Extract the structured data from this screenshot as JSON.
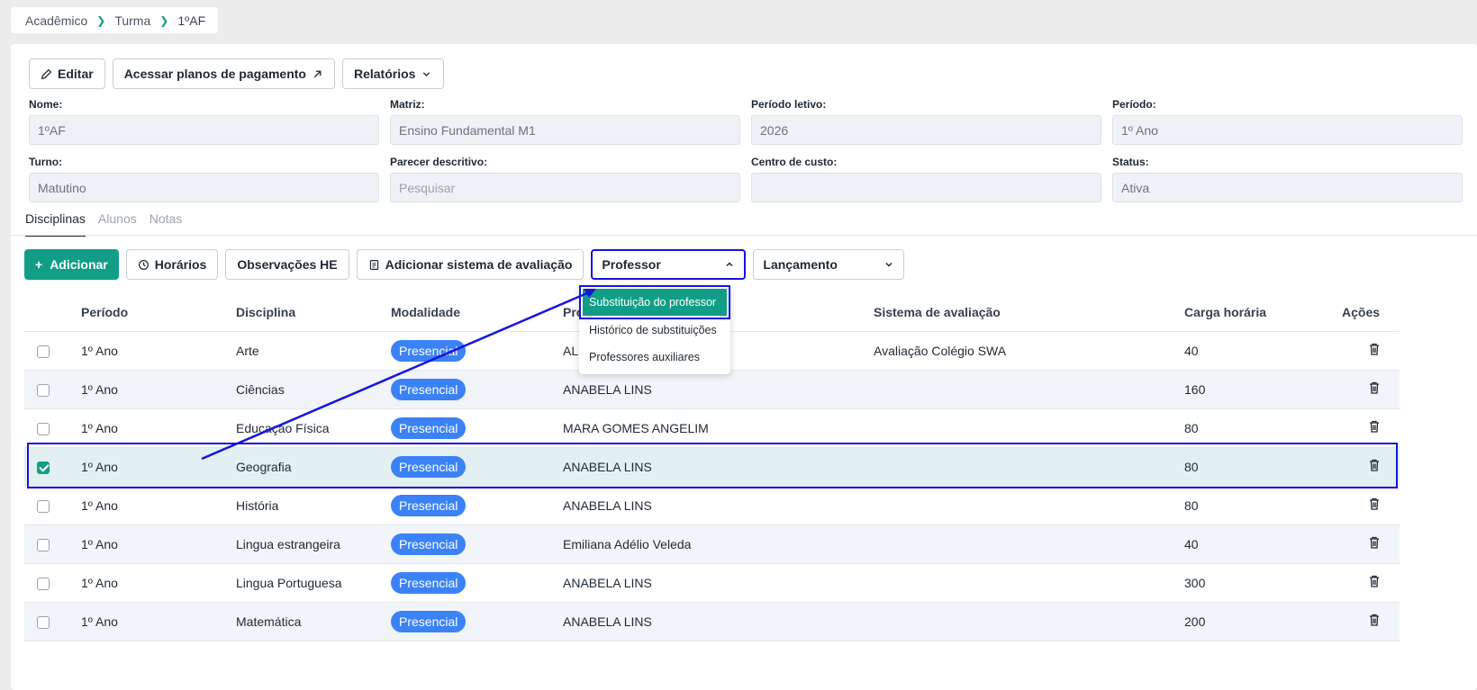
{
  "breadcrumb": {
    "items": [
      "Acadêmico",
      "Turma"
    ],
    "current": "1ºAF"
  },
  "toolbar": {
    "edit": "Editar",
    "payment_plans": "Acessar planos de pagamento",
    "reports": "Relatórios"
  },
  "fields": {
    "nome": {
      "label": "Nome:",
      "value": "1ºAF"
    },
    "matriz": {
      "label": "Matriz:",
      "value": "Ensino Fundamental M1"
    },
    "periodo_letivo": {
      "label": "Período letivo:",
      "value": "2026"
    },
    "periodo": {
      "label": "Período:",
      "value": "1º Ano"
    },
    "turno": {
      "label": "Turno:",
      "value": "Matutino"
    },
    "parecer": {
      "label": "Parecer descritivo:",
      "placeholder": "Pesquisar"
    },
    "centro_custo": {
      "label": "Centro de custo:",
      "value": ""
    },
    "status": {
      "label": "Status:",
      "value": "Ativa"
    }
  },
  "tabs": [
    "Disciplinas",
    "Alunos",
    "Notas"
  ],
  "actions": {
    "add": "Adicionar",
    "schedules": "Horários",
    "notes_he": "Observações HE",
    "add_eval": "Adicionar sistema de avaliação",
    "professor_select": "Professor",
    "lancamento_select": "Lançamento"
  },
  "professor_menu": [
    "Substituição do professor",
    "Histórico de substituições",
    "Professores auxiliares"
  ],
  "table": {
    "headers": [
      "Período",
      "Disciplina",
      "Modalidade",
      "Pro",
      "Sistema de avaliação",
      "Carga horária",
      "Ações"
    ],
    "rows": [
      {
        "periodo": "1º Ano",
        "disciplina": "Arte",
        "modalidade": "Presencial",
        "professor": "AL",
        "sistema": "Avaliação Colégio SWA",
        "carga": "40"
      },
      {
        "periodo": "1º Ano",
        "disciplina": "Ciências",
        "modalidade": "Presencial",
        "professor": "ANABELA LINS",
        "sistema": "",
        "carga": "160"
      },
      {
        "periodo": "1º Ano",
        "disciplina": "Educação Física",
        "modalidade": "Presencial",
        "professor": "MARA GOMES ANGELIM",
        "sistema": "",
        "carga": "80"
      },
      {
        "periodo": "1º Ano",
        "disciplina": "Geografia",
        "modalidade": "Presencial",
        "professor": "ANABELA LINS",
        "sistema": "",
        "carga": "80"
      },
      {
        "periodo": "1º Ano",
        "disciplina": "História",
        "modalidade": "Presencial",
        "professor": "ANABELA LINS",
        "sistema": "",
        "carga": "80"
      },
      {
        "periodo": "1º Ano",
        "disciplina": "Lingua estrangeira",
        "modalidade": "Presencial",
        "professor": "Emiliana Adélio Veleda",
        "sistema": "",
        "carga": "40"
      },
      {
        "periodo": "1º Ano",
        "disciplina": "Lingua Portuguesa",
        "modalidade": "Presencial",
        "professor": "ANABELA LINS",
        "sistema": "",
        "carga": "300"
      },
      {
        "periodo": "1º Ano",
        "disciplina": "Matemática",
        "modalidade": "Presencial",
        "professor": "ANABELA LINS",
        "sistema": "",
        "carga": "200"
      }
    ]
  },
  "colors": {
    "accent": "#129e86",
    "badge": "#3b82f6",
    "annotation": "#1515e0"
  }
}
